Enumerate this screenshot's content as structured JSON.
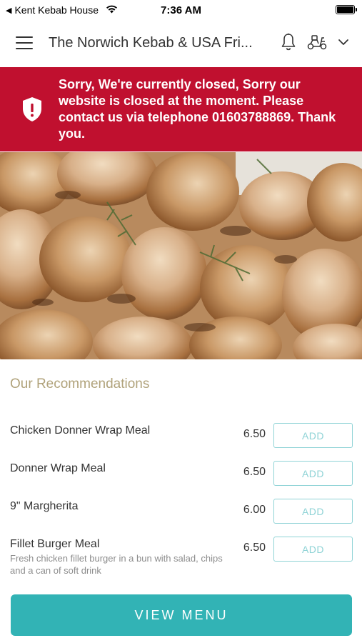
{
  "status_bar": {
    "back_app": "Kent Kebab House",
    "time": "7:36 AM"
  },
  "header": {
    "title": "The Norwich Kebab & USA Fri...",
    "icons": [
      "menu-icon",
      "bell-icon",
      "scooter-icon",
      "chevron-down-icon"
    ]
  },
  "closed_banner": {
    "message": "Sorry, We're currently closed, Sorry our website is closed at the moment. Please contact us via telephone 01603788869. Thank you.",
    "icon": "shield-alert-icon",
    "color": "#c0102f"
  },
  "recommendations": {
    "title": "Our Recommendations",
    "add_label": "ADD",
    "items": [
      {
        "name": "Chicken Donner Wrap Meal",
        "description": "",
        "price": "6.50"
      },
      {
        "name": "Donner Wrap Meal",
        "description": "",
        "price": "6.50"
      },
      {
        "name": "9\" Margherita",
        "description": "",
        "price": "6.00"
      },
      {
        "name": "Fillet Burger Meal",
        "description": "Fresh chicken fillet burger in a bun with salad, chips and a can of soft drink",
        "price": "6.50"
      }
    ]
  },
  "view_menu": {
    "label": "VIEW MENU",
    "color": "#32b3b5"
  }
}
